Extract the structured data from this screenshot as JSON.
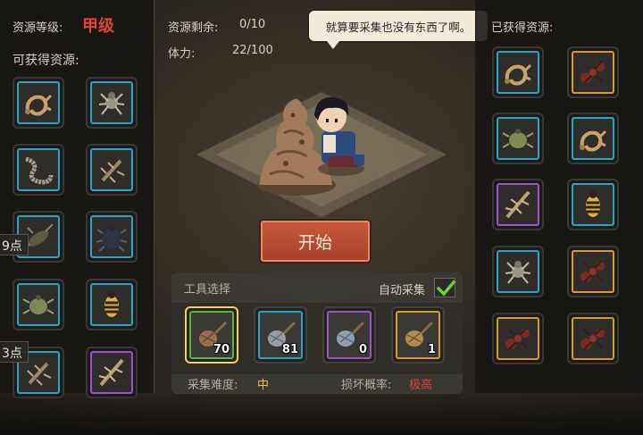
{
  "header": {
    "grade_label": "资源等级:",
    "grade_value": "甲级",
    "available_title": "可获得资源:",
    "remaining_label": "资源剩余:",
    "remaining_value": "0/10",
    "stamina_label": "体力:",
    "stamina_value": "22/100",
    "obtained_title": "已获得资源:"
  },
  "speech_bubble": "就算要采集也没有东西了啊。",
  "side_chips": [
    "9点",
    "3点"
  ],
  "available_resources": [
    {
      "icon": "scorpion-icon",
      "rarity": "blue"
    },
    {
      "icon": "spider-icon",
      "rarity": "blue"
    },
    {
      "icon": "centipede-icon",
      "rarity": "blue"
    },
    {
      "icon": "mantis-icon",
      "rarity": "blue"
    },
    {
      "icon": "cricket-icon",
      "rarity": "blue"
    },
    {
      "icon": "beetle-icon",
      "rarity": "blue"
    },
    {
      "icon": "tick-icon",
      "rarity": "blue"
    },
    {
      "icon": "wasp-icon",
      "rarity": "blue"
    },
    {
      "icon": "mantis-icon",
      "rarity": "blue"
    },
    {
      "icon": "stick-bug-icon",
      "rarity": "purple"
    }
  ],
  "obtained_resources": [
    {
      "icon": "scorpion-icon",
      "rarity": "blue"
    },
    {
      "icon": "red-ant-icon",
      "rarity": "gold"
    },
    {
      "icon": "tick-icon",
      "rarity": "blue"
    },
    {
      "icon": "scorpion-icon",
      "rarity": "blue"
    },
    {
      "icon": "stick-bug-icon",
      "rarity": "purple"
    },
    {
      "icon": "wasp-icon",
      "rarity": "blue"
    },
    {
      "icon": "spider-icon",
      "rarity": "blue"
    },
    {
      "icon": "red-ant-icon",
      "rarity": "gold"
    },
    {
      "icon": "red-ant-icon",
      "rarity": "gold"
    },
    {
      "icon": "red-ant-icon",
      "rarity": "gold"
    }
  ],
  "start_button": "开始",
  "tools": {
    "title": "工具选择",
    "auto_label": "自动采集",
    "auto_checked": true,
    "items": [
      {
        "icon": "wooden-net-icon",
        "count": "70",
        "rarity": "green",
        "selected": true
      },
      {
        "icon": "steel-net-icon",
        "count": "81",
        "rarity": "blue",
        "selected": false
      },
      {
        "icon": "silver-net-icon",
        "count": "0",
        "rarity": "purple",
        "selected": false
      },
      {
        "icon": "gold-net-icon",
        "count": "1",
        "rarity": "gold",
        "selected": false
      }
    ],
    "difficulty_label": "采集难度:",
    "difficulty_value": "中",
    "break_label": "损坏概率:",
    "break_value": "极高"
  },
  "colors": {
    "grade": "#e0463a",
    "difficulty": "#e8c44a",
    "break_rate": "#e0463a",
    "rarity_blue": "#27a4c6",
    "rarity_gold": "#d79a2c",
    "rarity_purple": "#9a56c8",
    "rarity_green": "#64a83a",
    "start_button": "#b94d31"
  }
}
